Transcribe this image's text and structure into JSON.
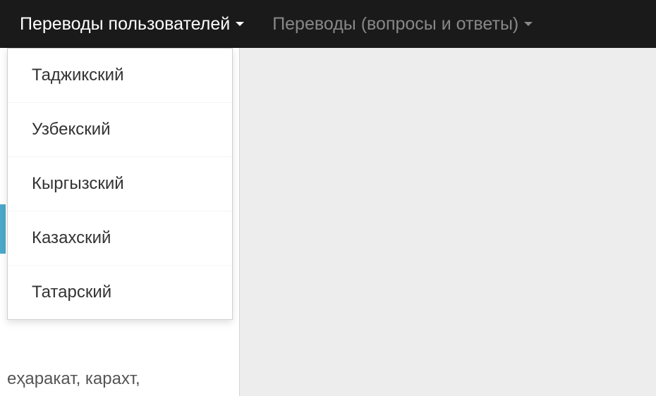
{
  "navbar": {
    "items": [
      {
        "label": "Переводы пользователей"
      },
      {
        "label": "Переводы (вопросы и ответы)"
      }
    ]
  },
  "dropdown": {
    "items": [
      {
        "label": "Таджикский"
      },
      {
        "label": "Узбекский"
      },
      {
        "label": "Кыргызский"
      },
      {
        "label": "Казахский"
      },
      {
        "label": "Татарский"
      }
    ]
  },
  "background": {
    "partial_text": "еҳаракат, карахт,"
  }
}
